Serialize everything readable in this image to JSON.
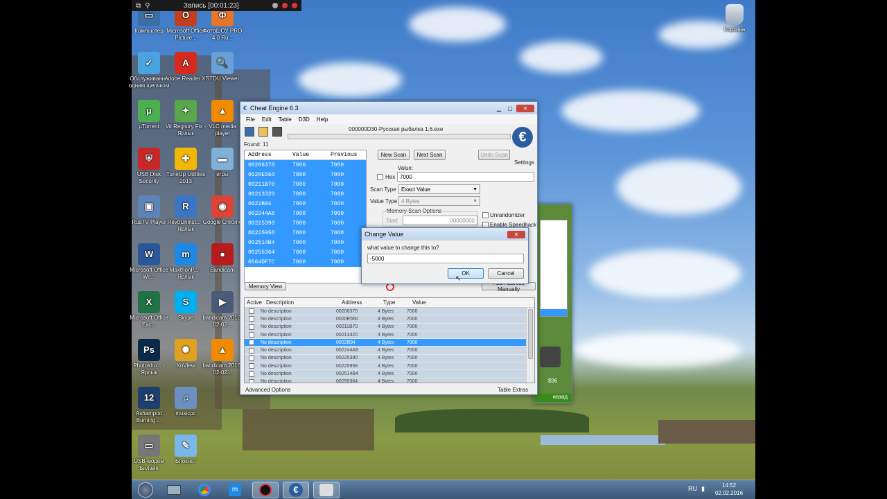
{
  "recording_bar": {
    "title": "Запись [00:01:23]"
  },
  "desktop_icons": [
    {
      "label": "Компьютер",
      "icon": "computer-icon",
      "color": "#3a6ea5",
      "glyph": "▭"
    },
    {
      "label": "Microsoft Office Picture...",
      "icon": "office-picture-icon",
      "color": "#c43e1c",
      "glyph": "O"
    },
    {
      "label": "ФотоШОУ PRO 4.0 Ru...",
      "icon": "fotoshow-icon",
      "color": "#e8742a",
      "glyph": "Ф"
    },
    {
      "label": "Обслуживание одним щелчком",
      "icon": "maintenance-icon",
      "color": "#4aa3df",
      "glyph": "✓"
    },
    {
      "label": "Adobe Reader XI",
      "icon": "adobe-reader-icon",
      "color": "#d42b1e",
      "glyph": "A"
    },
    {
      "label": "STDU Viewer",
      "icon": "stdu-viewer-icon",
      "color": "#6aa0d8",
      "glyph": "🔍"
    },
    {
      "label": "µTorrent",
      "icon": "utorrent-icon",
      "color": "#4caf50",
      "glyph": "µ"
    },
    {
      "label": "Vit Registry Fix - Ярлык",
      "icon": "registry-fix-icon",
      "color": "#5aa64a",
      "glyph": "✦"
    },
    {
      "label": "VLC media player",
      "icon": "vlc-icon",
      "color": "#f08a00",
      "glyph": "▲"
    },
    {
      "label": "USB Disk Security",
      "icon": "usb-security-icon",
      "color": "#c62828",
      "glyph": "⛨"
    },
    {
      "label": "TuneUp Utilities 2013",
      "icon": "tuneup-icon",
      "color": "#f2b705",
      "glyph": "✚"
    },
    {
      "label": "игры",
      "icon": "folder-icon",
      "color": "#7fb0d6",
      "glyph": "▬"
    },
    {
      "label": "RusTV Player",
      "icon": "rustv-icon",
      "color": "#5c84b8",
      "glyph": "▣"
    },
    {
      "label": "RevoUninst... - Ярлык",
      "icon": "revo-uninstaller-icon",
      "color": "#3b76c4",
      "glyph": "R"
    },
    {
      "label": "Google Chrome",
      "icon": "chrome-icon",
      "color": "#db4437",
      "glyph": "◉"
    },
    {
      "label": "Microsoft Office Wo...",
      "icon": "word-icon",
      "color": "#2b579a",
      "glyph": "W"
    },
    {
      "label": "MaxthonP... - Ярлык",
      "icon": "maxthon-icon",
      "color": "#1e88e5",
      "glyph": "m"
    },
    {
      "label": "Bandicam",
      "icon": "bandicam-icon",
      "color": "#b71c1c",
      "glyph": "●"
    },
    {
      "label": "Microsoft Office Exc...",
      "icon": "excel-icon",
      "color": "#217346",
      "glyph": "X"
    },
    {
      "label": "Skype",
      "icon": "skype-icon",
      "color": "#00aff0",
      "glyph": "S"
    },
    {
      "label": "bandicam 2016-02-02...",
      "icon": "video-file-icon",
      "color": "#4a5b7a",
      "glyph": "▶"
    },
    {
      "label": "Photosho... - Ярлык",
      "icon": "photoshop-icon",
      "color": "#0b2a4a",
      "glyph": "Ps"
    },
    {
      "label": "XnView",
      "icon": "xnview-icon",
      "color": "#e0a020",
      "glyph": "✺"
    },
    {
      "label": "bandicam 2016-02-02...",
      "icon": "vlc-file-icon",
      "color": "#f08a00",
      "glyph": "▲"
    },
    {
      "label": "Ashampoo Burning ...",
      "icon": "ashampoo-icon",
      "color": "#1d3f6e",
      "glyph": "12"
    },
    {
      "label": "musicpc",
      "icon": "music-icon",
      "color": "#6a8fc0",
      "glyph": "♫"
    },
    {
      "label": "",
      "icon": "",
      "color": "",
      "glyph": ""
    },
    {
      "label": "USB-модем Билайн",
      "icon": "modem-icon",
      "color": "#777777",
      "glyph": "▭"
    },
    {
      "label": "Блокнот",
      "icon": "notepad-icon",
      "color": "#79b8e8",
      "glyph": "✎"
    }
  ],
  "recycle_bin": {
    "label": "Корзина",
    "icon": "recycle-bin-icon"
  },
  "cheat_engine": {
    "title": "Cheat Engine 6.3",
    "menu": [
      "File",
      "Edit",
      "Table",
      "D3D",
      "Help"
    ],
    "process": "000000D30-Русская рыбалка 1.6.exe",
    "found": "Found: 11",
    "headers": [
      "Address",
      "Value",
      "Previous"
    ],
    "results": [
      [
        "00206370",
        "7000",
        "7000"
      ],
      [
        "0020E560",
        "7000",
        "7000"
      ],
      [
        "00211B70",
        "7000",
        "7000"
      ],
      [
        "00213320",
        "7000",
        "7000"
      ],
      [
        "0022B94",
        "7000",
        "7000"
      ],
      [
        "002244A8",
        "7000",
        "7000"
      ],
      [
        "00225390",
        "7000",
        "7000"
      ],
      [
        "00225958",
        "7000",
        "7000"
      ],
      [
        "002514B4",
        "7000",
        "7000"
      ],
      [
        "00255364",
        "7000",
        "7000"
      ],
      [
        "0564DF7C",
        "7000",
        "7000"
      ]
    ],
    "new_scan": "New Scan",
    "next_scan": "Next Scan",
    "undo_scan": "Undo Scan",
    "settings": "Settings",
    "value_label": "Value:",
    "hex_label": "Hex",
    "value": "7000",
    "scan_type_label": "Scan Type",
    "scan_type": "Exact Value",
    "value_type_label": "Value Type",
    "value_type": "4 Bytes",
    "memory_scan_options": "Memory Scan Options",
    "start_label": "Start",
    "start_value": "00000000",
    "unrandomizer": "Unrandomizer",
    "enable_speedhack": "Enable Speedhack",
    "memory_view": "Memory View",
    "add_address": "Add Address Manually",
    "table_headers": [
      "Active",
      "Description",
      "Address",
      "Type",
      "Value"
    ],
    "table_rows": [
      [
        "No description",
        "00206370",
        "4 Bytes",
        "7000"
      ],
      [
        "No description",
        "0020E560",
        "4 Bytes",
        "7000"
      ],
      [
        "No description",
        "00211B70",
        "4 Bytes",
        "7000"
      ],
      [
        "No description",
        "00213320",
        "4 Bytes",
        "7000"
      ],
      [
        "No description",
        "0022B94",
        "4 Bytes",
        "7000"
      ],
      [
        "No description",
        "002244A8",
        "4 Bytes",
        "7000"
      ],
      [
        "No description",
        "00225390",
        "4 Bytes",
        "7000"
      ],
      [
        "No description",
        "00225958",
        "4 Bytes",
        "7000"
      ],
      [
        "No description",
        "002514B4",
        "4 Bytes",
        "7000"
      ],
      [
        "No description",
        "00255364",
        "4 Bytes",
        "7000"
      ]
    ],
    "advanced_options": "Advanced Options",
    "table_extras": "Table Extras"
  },
  "change_value": {
    "title": "Change Value",
    "prompt": "what value to change this to?",
    "input": "-5000",
    "ok": "OK",
    "cancel": "Cancel"
  },
  "bg_window": {
    "price": "$96",
    "nav": "назад"
  },
  "taskbar": {
    "language": "RU",
    "time": "14:52",
    "date": "02.02.2016"
  }
}
